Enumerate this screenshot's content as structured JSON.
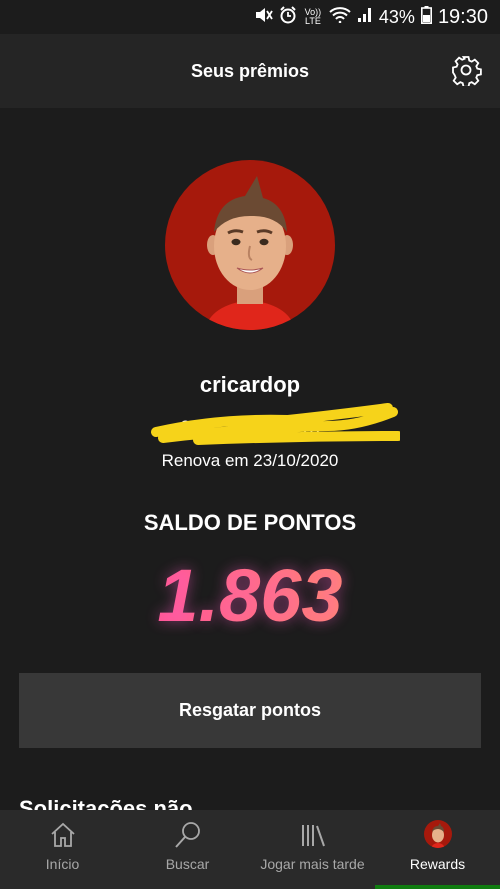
{
  "status_bar": {
    "icons": [
      "mute-icon",
      "alarm-icon",
      "volte-icon",
      "wifi-icon",
      "signal-icon",
      "battery-icon"
    ],
    "volte_label": "Vo)) LTE",
    "battery": "43%",
    "time": "19:30"
  },
  "header": {
    "title": "Seus prêmios",
    "settings_icon": "gear-icon"
  },
  "profile": {
    "username": "cricardop",
    "email_visible": "car_              @       ail.com",
    "renewal": "Renova em 23/10/2020"
  },
  "points": {
    "label": "SALDO DE PONTOS",
    "value": "1.863"
  },
  "redeem_button": "Resgatar pontos",
  "section_peek": "Solicitações não",
  "tabs": [
    {
      "label": "Início",
      "icon": "home-icon"
    },
    {
      "label": "Buscar",
      "icon": "search-icon"
    },
    {
      "label": "Jogar mais tarde",
      "icon": "library-icon"
    },
    {
      "label": "Rewards",
      "icon": "avatar-icon",
      "active": true
    }
  ],
  "colors": {
    "background": "#1c1c1c",
    "header": "#252525",
    "button": "#383838",
    "avatar_bg": "#a6190c",
    "points_gradient": [
      "#ff2fb9",
      "#ffb24a"
    ],
    "active_tab": "#107c10",
    "redaction_scribble": "#f6d31a"
  }
}
